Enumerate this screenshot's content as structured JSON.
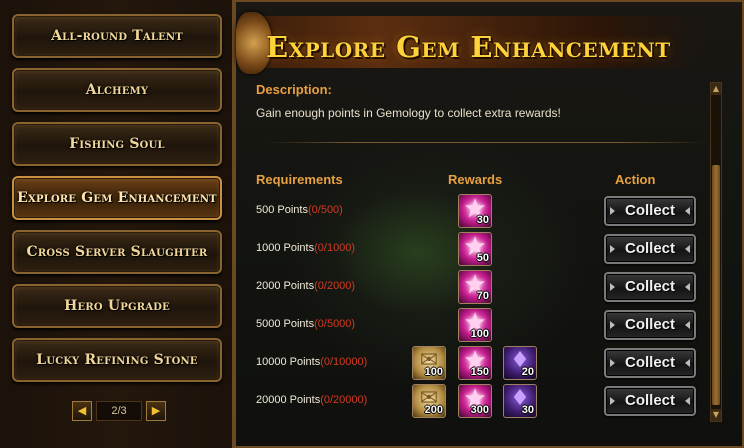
{
  "sidebar": {
    "items": [
      {
        "label": "All-round Talent",
        "active": false
      },
      {
        "label": "Alchemy",
        "active": false
      },
      {
        "label": "Fishing Soul",
        "active": false
      },
      {
        "label": "Explore Gem Enhancement",
        "active": true
      },
      {
        "label": "Cross Server Slaughter",
        "active": false
      },
      {
        "label": "Hero Upgrade",
        "active": false
      },
      {
        "label": "Lucky Refining Stone",
        "active": false
      }
    ],
    "pager": {
      "text": "2/3",
      "prev_icon": "arrow-left-icon",
      "next_icon": "arrow-right-icon"
    }
  },
  "main": {
    "title": "Explore Gem Enhancement",
    "description_label": "Description:",
    "description": "Gain enough points in Gemology to collect extra rewards!",
    "headers": {
      "requirements": "Requirements",
      "rewards": "Rewards",
      "action": "Action"
    },
    "rows": [
      {
        "requirement": "500 Points",
        "progress": "(0/500)",
        "rewards": [
          {
            "icon": "pink-star-icon",
            "qty": "30"
          }
        ],
        "action": "Collect"
      },
      {
        "requirement": "1000 Points",
        "progress": "(0/1000)",
        "rewards": [
          {
            "icon": "pink-star-icon",
            "qty": "50"
          }
        ],
        "action": "Collect"
      },
      {
        "requirement": "2000 Points",
        "progress": "(0/2000)",
        "rewards": [
          {
            "icon": "pink-star-icon",
            "qty": "70"
          }
        ],
        "action": "Collect"
      },
      {
        "requirement": "5000 Points",
        "progress": "(0/5000)",
        "rewards": [
          {
            "icon": "pink-star-icon",
            "qty": "100"
          }
        ],
        "action": "Collect"
      },
      {
        "requirement": "10000 Points",
        "progress": "(0/10000)",
        "rewards": [
          {
            "icon": "scroll-icon",
            "qty": "100"
          },
          {
            "icon": "pink-star-icon",
            "qty": "150"
          },
          {
            "icon": "purple-crystal-icon",
            "qty": "20"
          }
        ],
        "action": "Collect"
      },
      {
        "requirement": "20000 Points",
        "progress": "(0/20000)",
        "rewards": [
          {
            "icon": "scroll-icon",
            "qty": "200"
          },
          {
            "icon": "pink-star-icon",
            "qty": "300"
          },
          {
            "icon": "purple-crystal-icon",
            "qty": "30"
          }
        ],
        "action": "Collect"
      }
    ]
  },
  "colors": {
    "title": "#ffd23a",
    "header": "#e8a040",
    "progress": "#d23a22"
  }
}
